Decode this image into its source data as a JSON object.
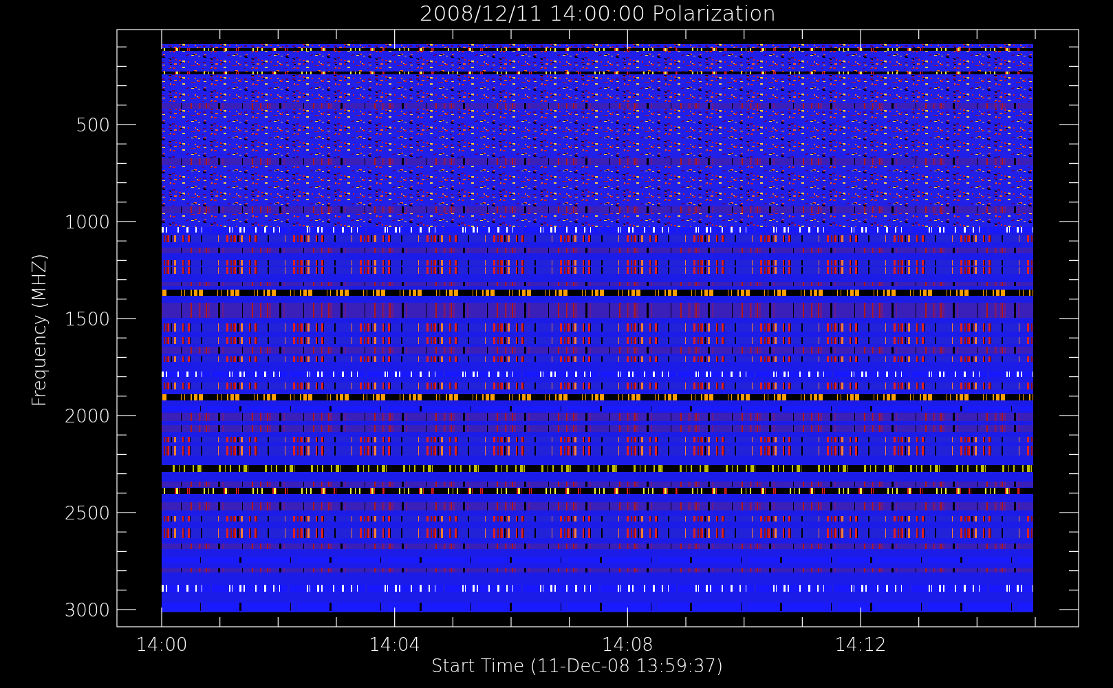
{
  "plot": {
    "title": "2008/12/11 14:00:00 Polarization",
    "ylabel": "Frequency (MHZ)",
    "xlabel": "Start Time (11-Dec-08 13:59:37)",
    "yticks": [
      "500",
      "1000",
      "1500",
      "2000",
      "2500",
      "3000"
    ],
    "xticks": [
      "14:00",
      "14:04",
      "14:08",
      "14:12"
    ]
  }
}
